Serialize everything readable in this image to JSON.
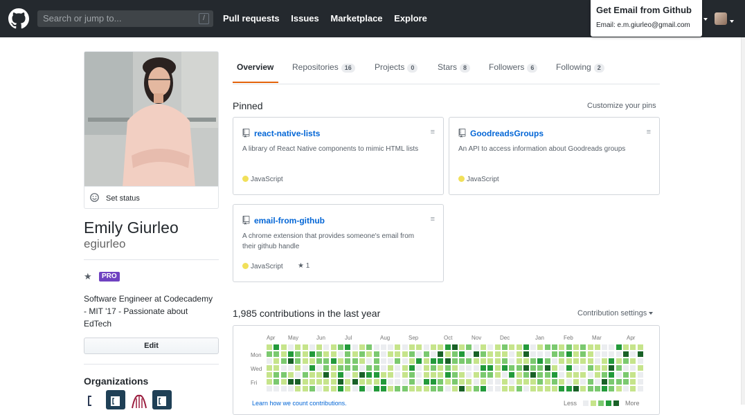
{
  "colors": {
    "header_bg": "#24292e",
    "link": "#0366d6",
    "pro_badge": "#6f42c1",
    "tab_underline": "#e36209",
    "javascript_dot": "#f1e05a",
    "contrib_levels": [
      "#ebedf0",
      "#c6e48b",
      "#7bc96f",
      "#239a3b",
      "#196127"
    ]
  },
  "header": {
    "search_placeholder": "Search or jump to...",
    "search_shortcut": "/",
    "nav": [
      "Pull requests",
      "Issues",
      "Marketplace",
      "Explore"
    ],
    "popup_title": "Get Email from Github",
    "popup_email": "Email: e.m.giurleo@gmail.com"
  },
  "profile": {
    "set_status": "Set status",
    "full_name": "Emily Giurleo",
    "username": "egiurleo",
    "pro_badge": "PRO",
    "bio_lines": [
      "Software Engineer at Codecademy",
      "- MIT '17 - Passionate about",
      "EdTech"
    ],
    "edit_label": "Edit",
    "orgs_title": "Organizations"
  },
  "tabs": [
    {
      "label": "Overview",
      "count": ""
    },
    {
      "label": "Repositories",
      "count": "16"
    },
    {
      "label": "Projects",
      "count": "0"
    },
    {
      "label": "Stars",
      "count": "8"
    },
    {
      "label": "Followers",
      "count": "6"
    },
    {
      "label": "Following",
      "count": "2"
    }
  ],
  "pinned": {
    "title": "Pinned",
    "customize": "Customize your pins",
    "repos": [
      {
        "name": "react-native-lists",
        "desc": "A library of React Native components to mimic HTML lists",
        "lang": "JavaScript",
        "stars": ""
      },
      {
        "name": "GoodreadsGroups",
        "desc": "An API to access information about Goodreads groups",
        "lang": "JavaScript",
        "stars": ""
      },
      {
        "name": "email-from-github",
        "desc": "A chrome extension that provides someone's email from their github handle",
        "lang": "JavaScript",
        "stars": "1"
      }
    ]
  },
  "contributions": {
    "title": "1,985 contributions in the last year",
    "settings": "Contribution settings",
    "months": [
      "Apr",
      "May",
      "Jun",
      "Jul",
      "Aug",
      "Sep",
      "Oct",
      "Nov",
      "Dec",
      "Jan",
      "Feb",
      "Mar",
      "Apr"
    ],
    "day_labels": [
      "Mon",
      "Wed",
      "Fri"
    ],
    "learn": "Learn how we count contributions.",
    "less": "Less",
    "more": "More"
  }
}
